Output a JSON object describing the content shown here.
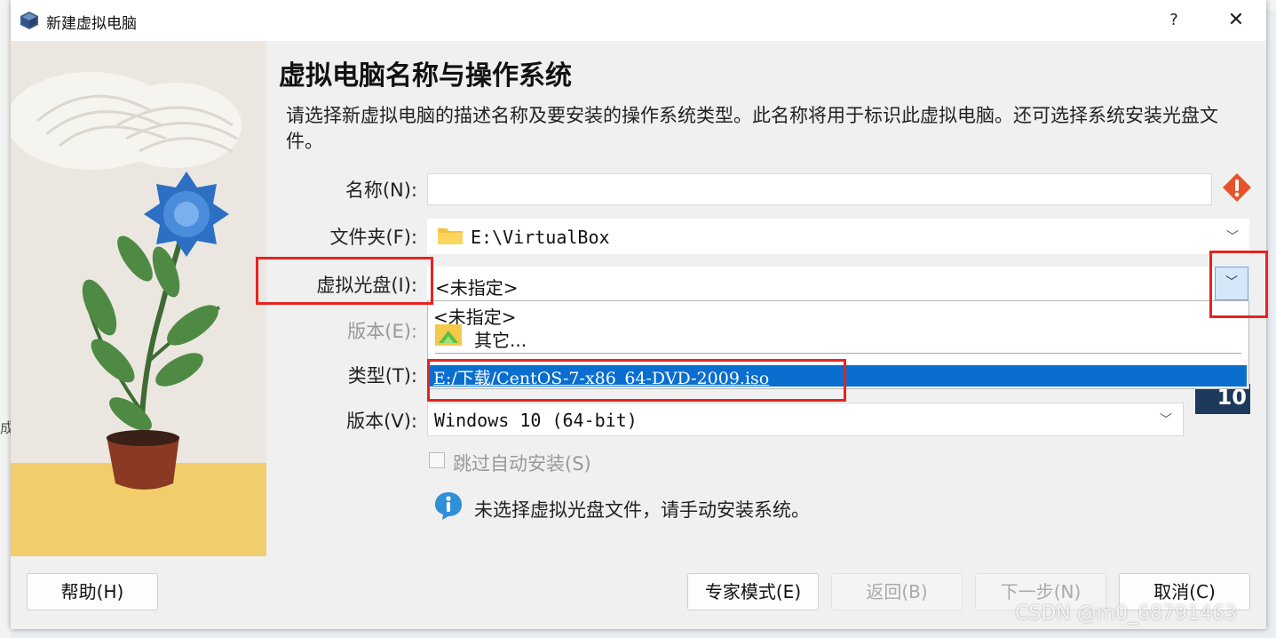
{
  "window": {
    "title": "新建虚拟电脑",
    "help_glyph": "?",
    "close_glyph": "✕"
  },
  "page": {
    "heading": "虚拟电脑名称与操作系统",
    "description": "请选择新虚拟电脑的描述名称及要安装的操作系统类型。此名称将用于标识此虚拟电脑。还可选择系统安装光盘文件。"
  },
  "form": {
    "name_label": "名称(N):",
    "name_value": "",
    "folder_label": "文件夹(F):",
    "folder_value": "E:\\VirtualBox",
    "iso_label": "虚拟光盘(I):",
    "iso_value": "<未指定>",
    "edition_label": "版本(E):",
    "type_label": "类型(T):",
    "version_label": "版本(V):",
    "version_value": "Windows 10 (64-bit)",
    "skip_unattended_label": "跳过自动安装(S)",
    "info_text": "未选择虚拟光盘文件，请手动安装系统。",
    "os_badge": "10"
  },
  "iso_dropdown": {
    "options": [
      "<未指定>",
      "其它...",
      "E:/下载/CentOS-7-x86_64-DVD-2009.iso"
    ],
    "selected_index": 2
  },
  "buttons": {
    "help": "帮助(H)",
    "expert": "专家模式(E)",
    "back": "返回(B)",
    "next": "下一步(N)",
    "cancel": "取消(C)"
  },
  "background": {
    "left_edge_text": "成"
  },
  "watermark": "CSDN @m0_68791463",
  "colors": {
    "accent": "#0a6ecf",
    "highlight_box": "#e8231f",
    "warning": "#e8532a",
    "info": "#2f8fd8"
  },
  "icons": [
    "virtualbox-icon",
    "warning-icon",
    "folder-icon",
    "chevron-down-icon",
    "other-file-icon",
    "windows10-badge-icon",
    "info-icon"
  ]
}
